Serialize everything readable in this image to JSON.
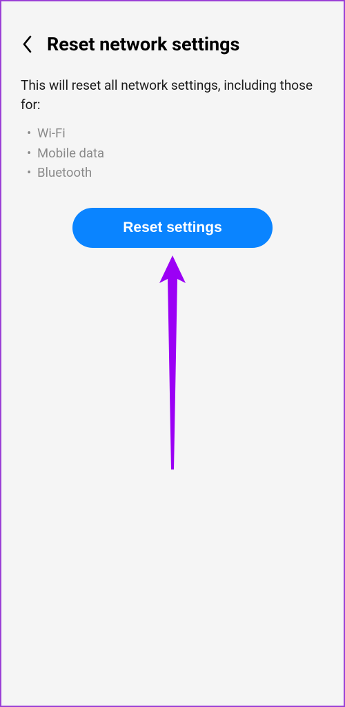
{
  "header": {
    "title": "Reset network settings"
  },
  "body": {
    "description": "This will reset all network settings, including those for:",
    "items": {
      "0": "Wi-Fi",
      "1": "Mobile data",
      "2": "Bluetooth"
    }
  },
  "actions": {
    "reset_button": "Reset settings"
  },
  "annotation": {
    "arrow_color": "#9b00f5"
  }
}
